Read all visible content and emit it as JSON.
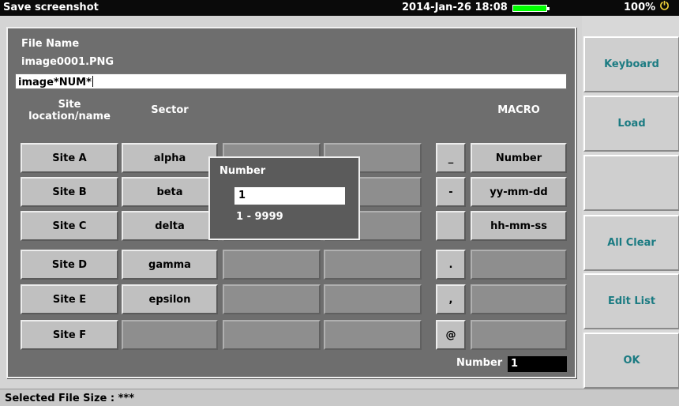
{
  "window": {
    "title": "Save screenshot",
    "datetime": "2014-Jan-26 18:08",
    "battery_percent": "100%",
    "battery_icon": "battery-icon",
    "power_icon": "power-plug-icon"
  },
  "file": {
    "name_label": "File Name",
    "current_name": "image0001.PNG",
    "input_value": "image*NUM*"
  },
  "headers": {
    "site": "Site\nlocation/name",
    "sector": "Sector",
    "macro": "MACRO"
  },
  "sites": [
    "Site A",
    "Site B",
    "Site C",
    "Site D",
    "Site E",
    "Site F"
  ],
  "sectors": [
    "alpha",
    "beta",
    "delta",
    "gamma",
    "epsilon",
    ""
  ],
  "symbols": [
    "_",
    "-",
    "",
    ".",
    ",",
    "@"
  ],
  "macros": [
    "Number",
    "yy-mm-dd",
    "hh-mm-ss",
    "",
    "",
    ""
  ],
  "popup": {
    "title": "Number",
    "value": "1",
    "range": "1 - 9999"
  },
  "number_field": {
    "label": "Number",
    "value": "1"
  },
  "softkeys": [
    "Keyboard",
    "Load",
    "",
    "All Clear",
    "Edit List",
    "OK"
  ],
  "status": {
    "text": "Selected File Size : ***"
  },
  "colors": {
    "softkey_text": "#1b7b82",
    "dialog_bg": "#6e6e6e",
    "battery": "#00ff00"
  }
}
